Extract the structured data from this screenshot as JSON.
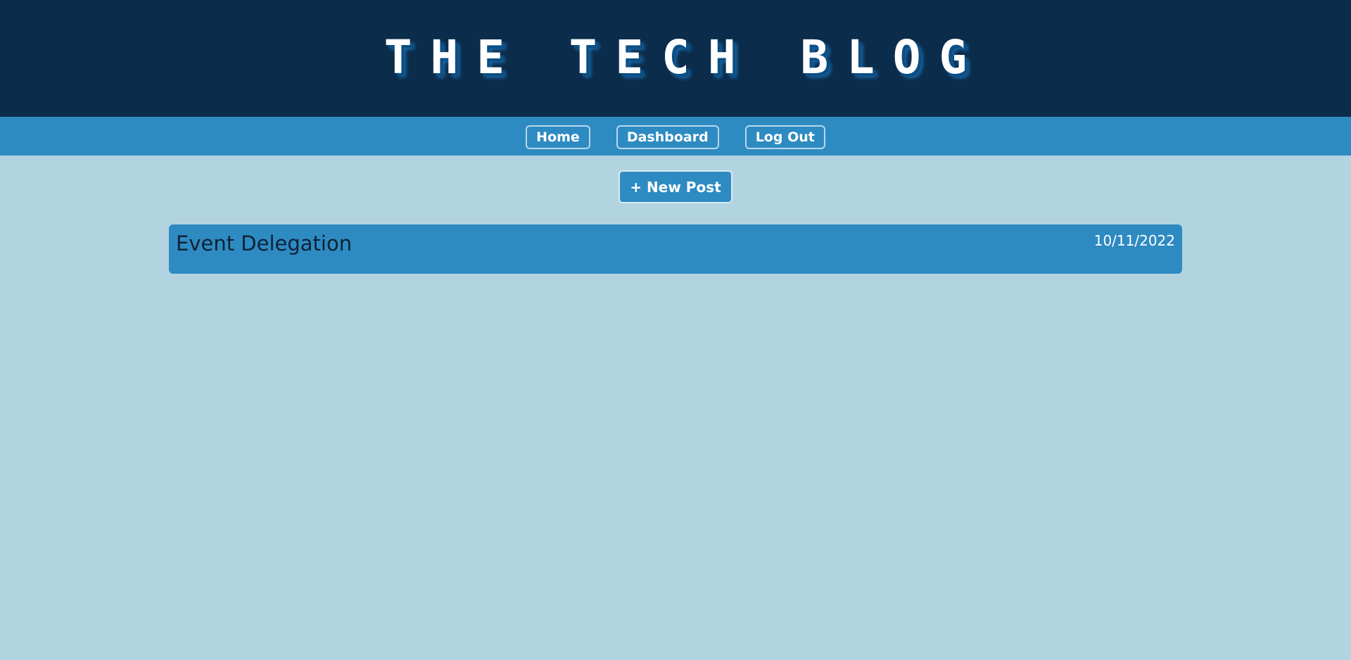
{
  "header": {
    "title": "THE TECH BLOG"
  },
  "nav": {
    "items": [
      {
        "label": "Home"
      },
      {
        "label": "Dashboard"
      },
      {
        "label": "Log Out"
      }
    ]
  },
  "dashboard": {
    "new_post_label": "+ New Post",
    "posts": [
      {
        "title": "Event Delegation",
        "date": "10/11/2022"
      }
    ]
  },
  "colors": {
    "header_bg": "#0b2c4b",
    "nav_bg": "#2e8bc2",
    "page_bg": "#b2d4e0",
    "card_bg": "#2e8bc2"
  }
}
